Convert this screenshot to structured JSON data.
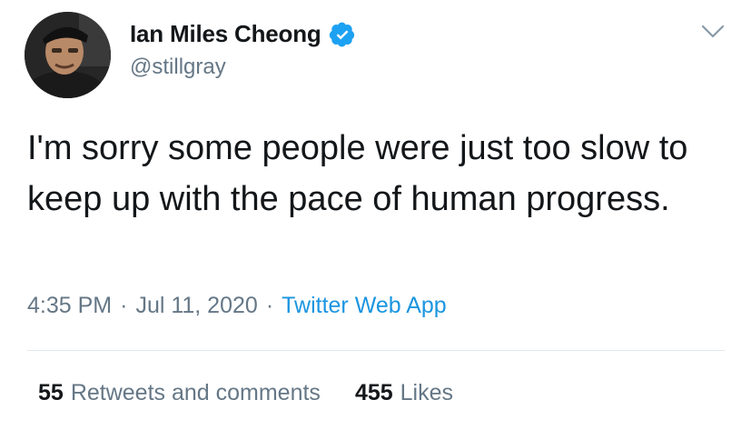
{
  "author": {
    "display_name": "Ian Miles Cheong",
    "handle": "@stillgray",
    "verified": true
  },
  "tweet": {
    "text": "I'm sorry some people were just too slow to keep up with the pace of human progress.",
    "time": "4:35 PM",
    "date": "Jul 11, 2020",
    "separator": "·",
    "source": "Twitter Web App"
  },
  "stats": {
    "retweets_count": "55",
    "retweets_label": "Retweets and comments",
    "likes_count": "455",
    "likes_label": "Likes"
  },
  "colors": {
    "text": "#14171a",
    "secondary": "#657786",
    "link": "#1b95e0",
    "verified": "#1da1f2",
    "divider": "#e1e8ed"
  },
  "icons": {
    "verified": "verified-badge-icon",
    "menu": "chevron-down-icon"
  }
}
